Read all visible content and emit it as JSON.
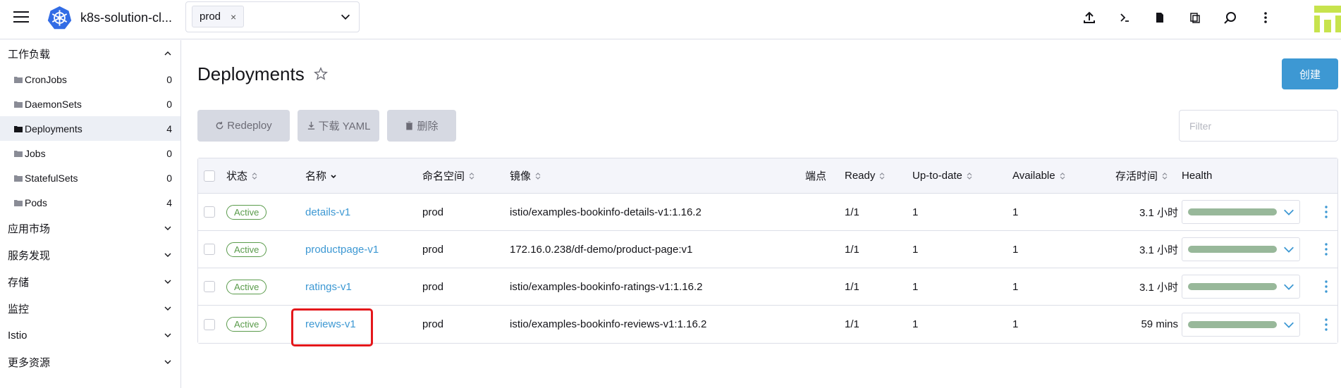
{
  "header": {
    "cluster_name": "k8s-solution-cl...",
    "namespace_chip": "prod",
    "chip_close": "×"
  },
  "sidebar": {
    "workloads_label": "工作负载",
    "items": [
      {
        "label": "CronJobs",
        "count": "0"
      },
      {
        "label": "DaemonSets",
        "count": "0"
      },
      {
        "label": "Deployments",
        "count": "4"
      },
      {
        "label": "Jobs",
        "count": "0"
      },
      {
        "label": "StatefulSets",
        "count": "0"
      },
      {
        "label": "Pods",
        "count": "4"
      }
    ],
    "groups": [
      "应用市场",
      "服务发现",
      "存储",
      "监控",
      "Istio",
      "更多资源"
    ]
  },
  "main": {
    "title": "Deployments",
    "create_label": "创建",
    "redeploy_label": "Redeploy",
    "download_label": "下载 YAML",
    "delete_label": "删除",
    "filter_placeholder": "Filter"
  },
  "table": {
    "headers": {
      "status": "状态",
      "name": "名称",
      "namespace": "命名空间",
      "image": "镜像",
      "endpoints": "端点",
      "ready": "Ready",
      "uptodate": "Up-to-date",
      "available": "Available",
      "age": "存活时间",
      "health": "Health"
    },
    "rows": [
      {
        "status": "Active",
        "name": "details-v1",
        "namespace": "prod",
        "image": "istio/examples-bookinfo-details-v1:1.16.2",
        "ready": "1/1",
        "uptodate": "1",
        "available": "1",
        "age": "3.1 小时"
      },
      {
        "status": "Active",
        "name": "productpage-v1",
        "namespace": "prod",
        "image": "172.16.0.238/df-demo/product-page:v1",
        "ready": "1/1",
        "uptodate": "1",
        "available": "1",
        "age": "3.1 小时"
      },
      {
        "status": "Active",
        "name": "ratings-v1",
        "namespace": "prod",
        "image": "istio/examples-bookinfo-ratings-v1:1.16.2",
        "ready": "1/1",
        "uptodate": "1",
        "available": "1",
        "age": "3.1 小时"
      },
      {
        "status": "Active",
        "name": "reviews-v1",
        "namespace": "prod",
        "image": "istio/examples-bookinfo-reviews-v1:1.16.2",
        "ready": "1/1",
        "uptodate": "1",
        "available": "1",
        "age": "59 mins"
      }
    ]
  },
  "colors": {
    "accent": "#3d98d3",
    "active_badge": "#5a9b4b",
    "health_bar": "#98b89a",
    "highlight": "#e4171b"
  }
}
